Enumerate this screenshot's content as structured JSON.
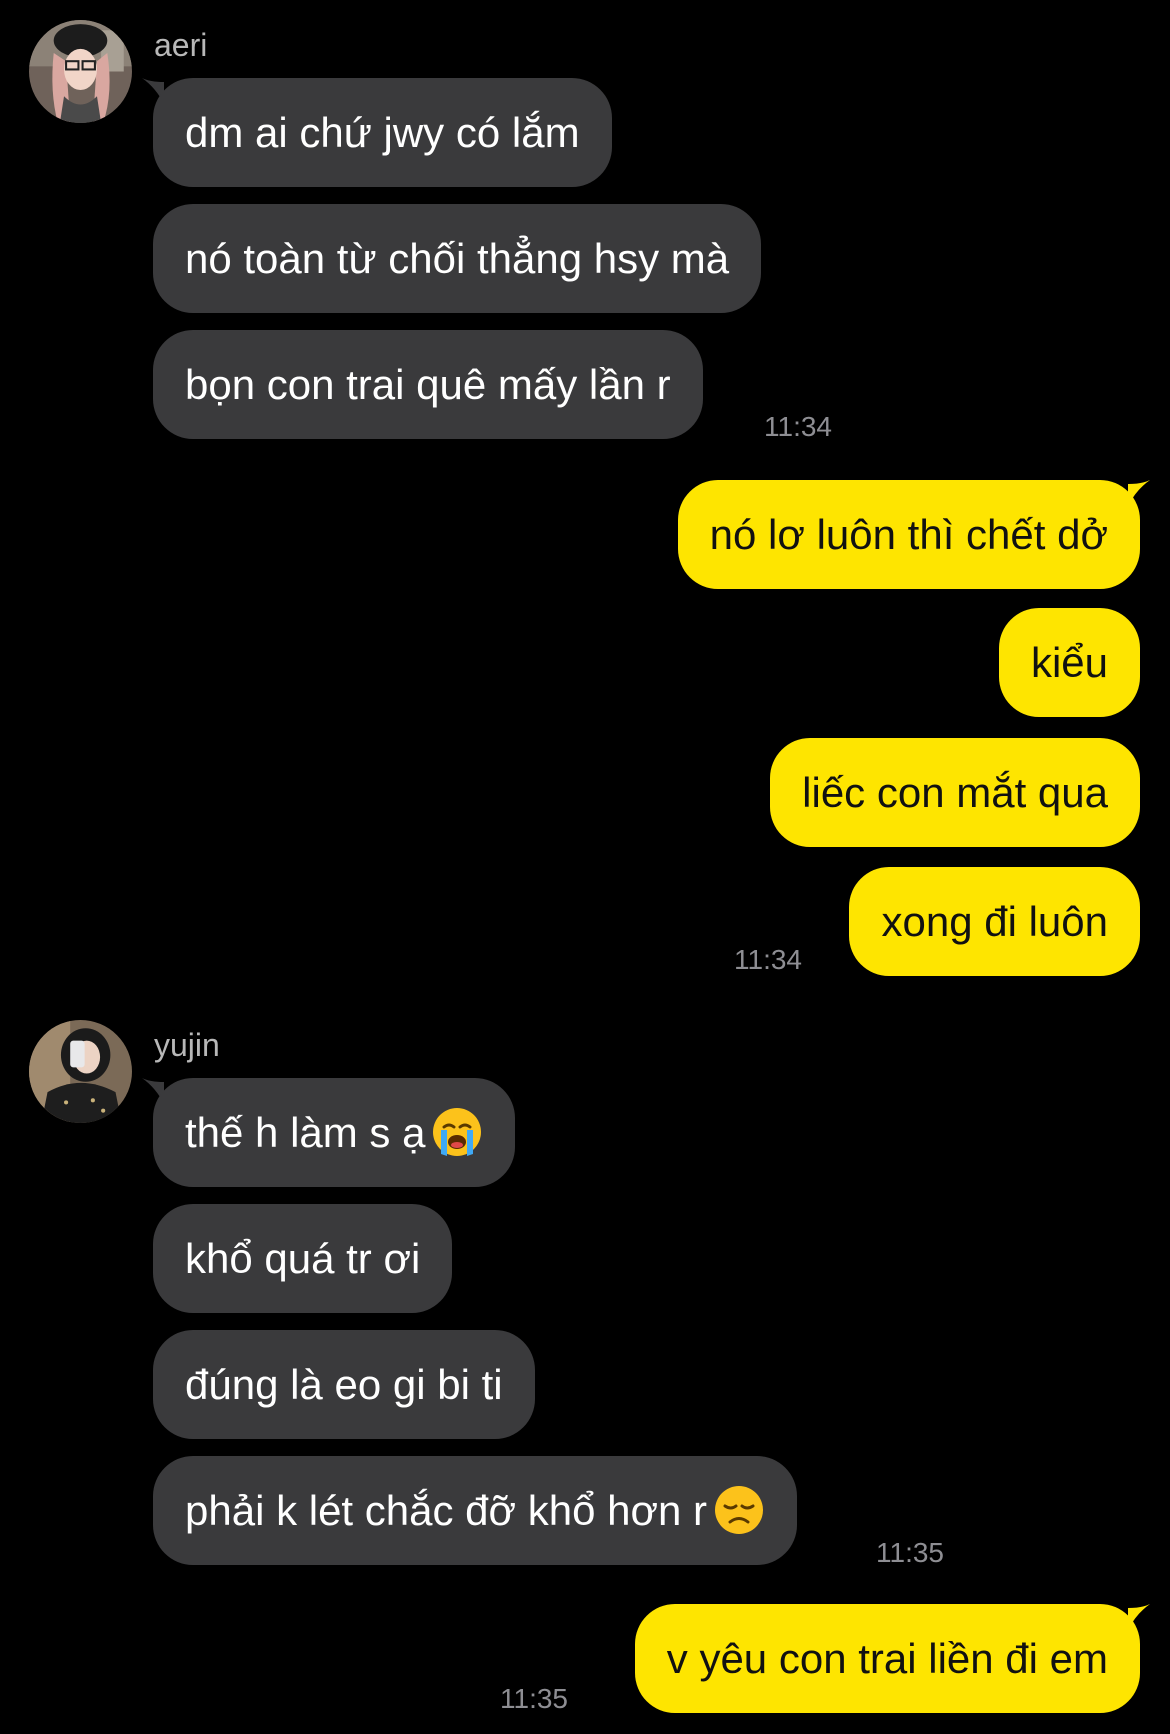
{
  "groups": [
    {
      "sender": "aeri",
      "avatar_icon": "aeri-avatar-icon",
      "messages": [
        "dm ai chứ jwy có lắm",
        "nó toàn từ chối thẳng hsy mà",
        "bọn con trai quê mấy lần r"
      ],
      "time": "11:34"
    },
    {
      "sender": "me",
      "messages": [
        "nó lơ luôn thì chết dở",
        "kiểu",
        "liếc con mắt qua",
        "xong đi luôn"
      ],
      "time": "11:34"
    },
    {
      "sender": "yujin",
      "avatar_icon": "yujin-avatar-icon",
      "messages": [
        "thế h làm s ạ",
        "khổ quá tr ơi",
        "đúng là eo gi bi ti",
        "phải k lét chắc đỡ khổ hơn r"
      ],
      "emojis": {
        "0": "loudly-crying-face-emoji",
        "3": "disappointed-face-emoji"
      },
      "time": "11:35"
    },
    {
      "sender": "me",
      "messages": [
        "v yêu con trai liền đi em"
      ],
      "time": "11:35"
    }
  ],
  "colors": {
    "background": "#000000",
    "incoming_bubble": "#3a3a3c",
    "outgoing_bubble": "#fee500",
    "timestamp": "#8e8e93",
    "sender_name": "#b8b8b8"
  }
}
